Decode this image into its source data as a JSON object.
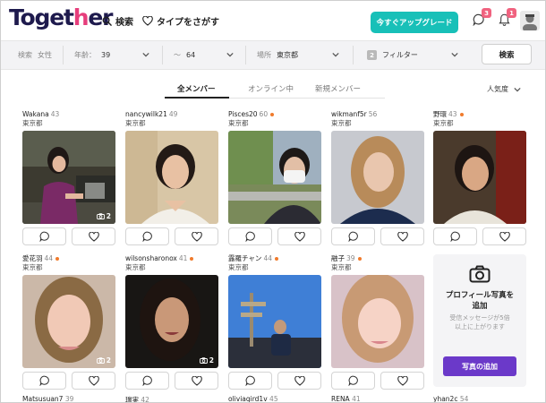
{
  "header": {
    "logo_main": "Toget",
    "logo_accent": "h",
    "logo_end": "er",
    "search_label": "検索",
    "type_label": "タイプをさがす",
    "upgrade_label": "今すぐアップグレード",
    "messages_badge": "3",
    "notifications_badge": "1"
  },
  "filters": {
    "search_label": "検索",
    "search_value": "女性",
    "age_label": "年齢：",
    "age_min": "39",
    "age_sep": "〜",
    "age_max": "64",
    "place_label": "場所",
    "place_value": "東京都",
    "filter_count": "2",
    "filter_label": "フィルター",
    "search_button": "検索"
  },
  "tabs": [
    {
      "label": "全メンバー",
      "active": true
    },
    {
      "label": "オンライン中",
      "active": false
    },
    {
      "label": "新規メンバー",
      "active": false
    }
  ],
  "sort_label": "人気度",
  "members": [
    {
      "name": "Wakana",
      "age": "43",
      "location": "東京都",
      "online": false,
      "photo_count": "2"
    },
    {
      "name": "nancywilk21",
      "age": "49",
      "location": "東京都",
      "online": false,
      "photo_count": ""
    },
    {
      "name": "Pisces20",
      "age": "60",
      "location": "東京都",
      "online": true,
      "photo_count": ""
    },
    {
      "name": "wikmanf5r",
      "age": "56",
      "location": "東京都",
      "online": false,
      "photo_count": ""
    },
    {
      "name": "野環",
      "age": "43",
      "location": "東京都",
      "online": true,
      "photo_count": ""
    },
    {
      "name": "愛花羽",
      "age": "44",
      "location": "東京都",
      "online": true,
      "photo_count": "2"
    },
    {
      "name": "wilsonsharonox",
      "age": "41",
      "location": "東京都",
      "online": true,
      "photo_count": "2"
    },
    {
      "name": "露羅チャン",
      "age": "44",
      "location": "東京都",
      "online": true,
      "photo_count": ""
    },
    {
      "name": "融子",
      "age": "39",
      "location": "東京都",
      "online": true,
      "photo_count": ""
    }
  ],
  "promo": {
    "title_line1": "プロフィール写真を",
    "title_line2": "追加",
    "desc_line1": "受信メッセージが5倍",
    "desc_line2": "以上に上がります",
    "button": "写真の追加"
  },
  "row3": [
    {
      "name": "Matsusuan7",
      "age": "39"
    },
    {
      "name": "瑞実",
      "age": "42"
    },
    {
      "name": "oliviaqird1v",
      "age": "45"
    },
    {
      "name": "RENA",
      "age": "41"
    },
    {
      "name": "yhan2c",
      "age": "54"
    }
  ],
  "colors": {
    "brand_dark": "#1e1a4d",
    "brand_accent": "#e63e7c",
    "upgrade": "#18c0b8",
    "badge": "#f0627f",
    "online_dot": "#f07b2c",
    "promo_button": "#6b39c9"
  }
}
